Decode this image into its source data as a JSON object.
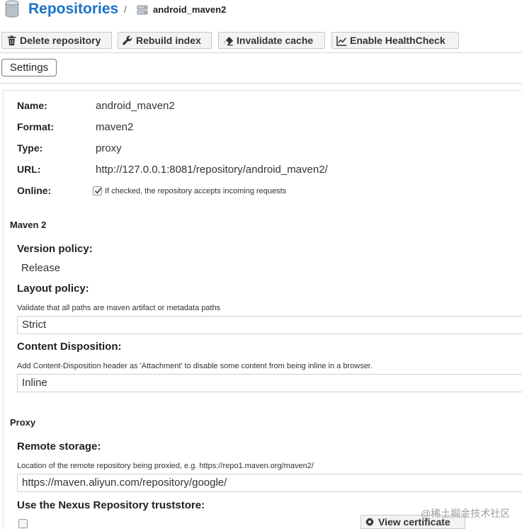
{
  "header": {
    "title": "Repositories",
    "separator": "/",
    "breadcrumb": "android_maven2",
    "icon": "database-icon",
    "crumb_icon": "server-icon",
    "title_color": "#1a73c8"
  },
  "toolbar": {
    "delete_label": "Delete repository",
    "rebuild_label": "Rebuild index",
    "invalidate_label": "Invalidate cache",
    "healthcheck_label": "Enable HealthCheck",
    "icons": [
      "trash-icon",
      "wrench-icon",
      "eraser-icon",
      "chart-line-icon"
    ]
  },
  "tabs": {
    "settings": "Settings"
  },
  "summary": {
    "name_label": "Name:",
    "name_value": "android_maven2",
    "format_label": "Format:",
    "format_value": "maven2",
    "type_label": "Type:",
    "type_value": "proxy",
    "url_label": "URL:",
    "url_value": "http://127.0.0.1:8081/repository/android_maven2/",
    "online_label": "Online:",
    "online_help": "If checked, the repository accepts incoming requests",
    "online_checked": true
  },
  "maven": {
    "section": "Maven 2",
    "version_label": "Version policy:",
    "version_value": "Release",
    "layout_label": "Layout policy:",
    "layout_help": "Validate that all paths are maven artifact or metadata paths",
    "layout_value": "Strict",
    "disposition_label": "Content Disposition:",
    "disposition_help": "Add Content-Disposition header as 'Attachment' to disable some content from being inline in a browser.",
    "disposition_value": "Inline"
  },
  "proxy": {
    "section": "Proxy",
    "remote_label": "Remote storage:",
    "remote_help": "Location of the remote repository being proxied, e.g. https://repo1.maven.org/maven2/",
    "remote_value": "https://maven.aliyun.com/repository/google/",
    "truststore_label": "Use the Nexus Repository truststore:",
    "view_cert_label": "View certificate",
    "view_cert_icon": "gear-icon"
  },
  "watermark": "@稀土掘金技术社区"
}
